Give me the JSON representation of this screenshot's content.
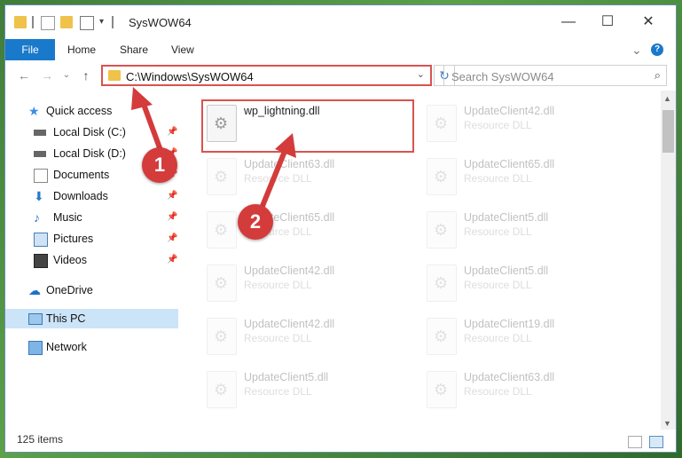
{
  "window": {
    "title": "SysWOW64",
    "minimize_glyph": "—",
    "maximize_glyph": "☐",
    "close_glyph": "✕"
  },
  "ribbon": {
    "tabs": [
      "File",
      "Home",
      "Share",
      "View"
    ],
    "expand_glyph": "⌄",
    "help_glyph": "?"
  },
  "navigation": {
    "back_glyph": "←",
    "forward_glyph": "→",
    "recent_glyph": "⌄",
    "up_glyph": "↑",
    "address": "C:\\Windows\\SysWOW64",
    "address_dropdown_glyph": "⌄",
    "refresh_glyph": "↻",
    "search_placeholder": "Search SysWOW64",
    "search_icon": "⌕"
  },
  "sidebar": {
    "items": [
      {
        "label": "Quick access",
        "icon": "star-icon",
        "pinned": false
      },
      {
        "label": "Local Disk (C:)",
        "icon": "drive-icon",
        "pinned": true
      },
      {
        "label": "Local Disk (D:)",
        "icon": "drive-icon",
        "pinned": true
      },
      {
        "label": "Documents",
        "icon": "documents-icon",
        "pinned": true
      },
      {
        "label": "Downloads",
        "icon": "download-icon",
        "pinned": true
      },
      {
        "label": "Music",
        "icon": "music-icon",
        "pinned": true
      },
      {
        "label": "Pictures",
        "icon": "pictures-icon",
        "pinned": true
      },
      {
        "label": "Videos",
        "icon": "videos-icon",
        "pinned": true
      },
      {
        "label": "OneDrive",
        "icon": "cloud-icon",
        "pinned": false
      },
      {
        "label": "This PC",
        "icon": "computer-icon",
        "pinned": false
      },
      {
        "label": "Network",
        "icon": "network-icon",
        "pinned": false
      }
    ],
    "pin_glyph": "📌"
  },
  "files": [
    {
      "name": "wp_lightning.dll",
      "type": ""
    },
    {
      "name": "UpdateClient42.dll",
      "type": "Resource DLL"
    },
    {
      "name": "UpdateClient63.dll",
      "type": "Resource DLL"
    },
    {
      "name": "UpdateClient65.dll",
      "type": "Resource DLL"
    },
    {
      "name": "UpdateClient65.dll",
      "type": "Resource DLL"
    },
    {
      "name": "UpdateClient5.dll",
      "type": "Resource DLL"
    },
    {
      "name": "UpdateClient42.dll",
      "type": "Resource DLL"
    },
    {
      "name": "UpdateClient5.dll",
      "type": "Resource DLL"
    },
    {
      "name": "UpdateClient42.dll",
      "type": "Resource DLL"
    },
    {
      "name": "UpdateClient19.dll",
      "type": "Resource DLL"
    },
    {
      "name": "UpdateClient5.dll",
      "type": "Resource DLL"
    },
    {
      "name": "UpdateClient63.dll",
      "type": "Resource DLL"
    }
  ],
  "scrollbar": {
    "up_glyph": "▲",
    "down_glyph": "▼"
  },
  "status": {
    "item_count": "125 items"
  },
  "annotations": {
    "step1": "1",
    "step2": "2",
    "color": "#d43b3b"
  }
}
